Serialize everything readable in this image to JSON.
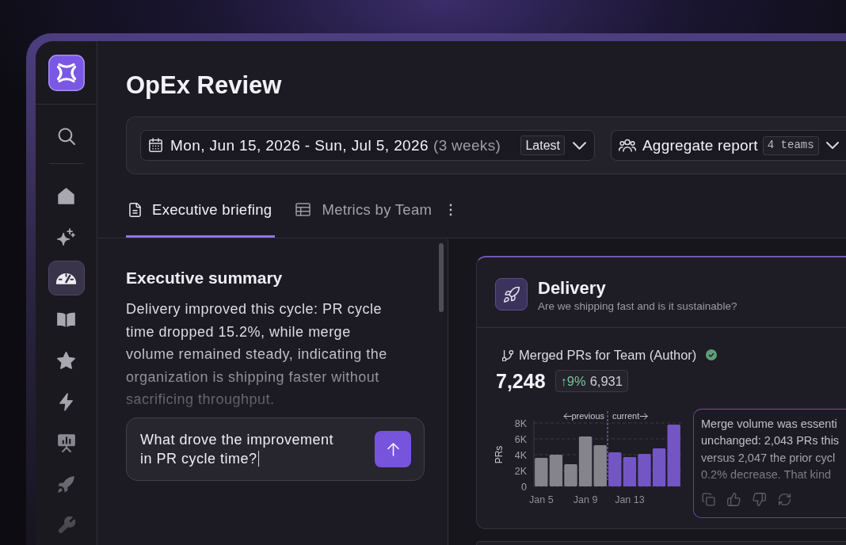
{
  "sidebar": {
    "items": [
      {
        "selected": false
      },
      {
        "selected": false
      },
      {
        "selected": true
      },
      {
        "selected": false
      },
      {
        "selected": false
      },
      {
        "selected": false
      },
      {
        "selected": false
      },
      {
        "selected": false
      },
      {
        "selected": false
      }
    ]
  },
  "page": {
    "title": "OpEx Review"
  },
  "filters": {
    "date_range": {
      "value": "Mon, Jun 15, 2026 - Sun, Jul 5, 2026",
      "duration": "(3 weeks)",
      "preset": "Latest"
    },
    "report": {
      "value": "Aggregate report",
      "teams": "4 teams"
    }
  },
  "tabs": [
    {
      "label": "Executive briefing",
      "selected": true
    },
    {
      "label": "Metrics by Team",
      "selected": false
    }
  ],
  "summary": {
    "heading": "Executive summary",
    "text": "Delivery improved this cycle: PR cycle time dropped 15.2%, while merge volume remained steady, indicating the organization is shipping faster without sacrificing throughput.",
    "prompt": {
      "value": "What drove the improvement in PR cycle time?"
    }
  },
  "delivery_card": {
    "title": "Delivery",
    "subtitle": "Are we shipping fast and is it sustainable?",
    "metric": {
      "label": "Merged PRs for Team (Author)",
      "verified": true,
      "value": "7,248",
      "change": "↑9%",
      "previous": "6,931"
    },
    "chart_data": {
      "type": "bar",
      "ylabel": "PRs",
      "categories": [
        "Jan 5",
        null,
        null,
        "Jan 9",
        null,
        null,
        "Jan 13",
        null,
        null,
        null
      ],
      "ylim": [
        0,
        8000
      ],
      "yticks": [
        {
          "value": 0,
          "label": "0"
        },
        {
          "value": 2000,
          "label": "2K"
        },
        {
          "value": 4000,
          "label": "4K"
        },
        {
          "value": 6000,
          "label": "6K"
        },
        {
          "value": 8000,
          "label": "8K"
        }
      ],
      "grid": true,
      "stacked": true,
      "series": [
        {
          "name": "previous",
          "color": "#85838b",
          "values": [
            3600,
            4000,
            2800,
            6300,
            5200,
            null,
            null,
            null,
            null,
            null
          ]
        },
        {
          "name": "current",
          "color": "#7455c4",
          "values": [
            null,
            null,
            null,
            null,
            null,
            4300,
            3700,
            4100,
            4800,
            7800
          ]
        }
      ]
    },
    "insight": {
      "lines": [
        "Merge volume was essenti",
        "unchanged: 2,043 PRs this",
        "versus 2,047 the prior cycl",
        "0.2% decrease. That kind"
      ]
    }
  }
}
